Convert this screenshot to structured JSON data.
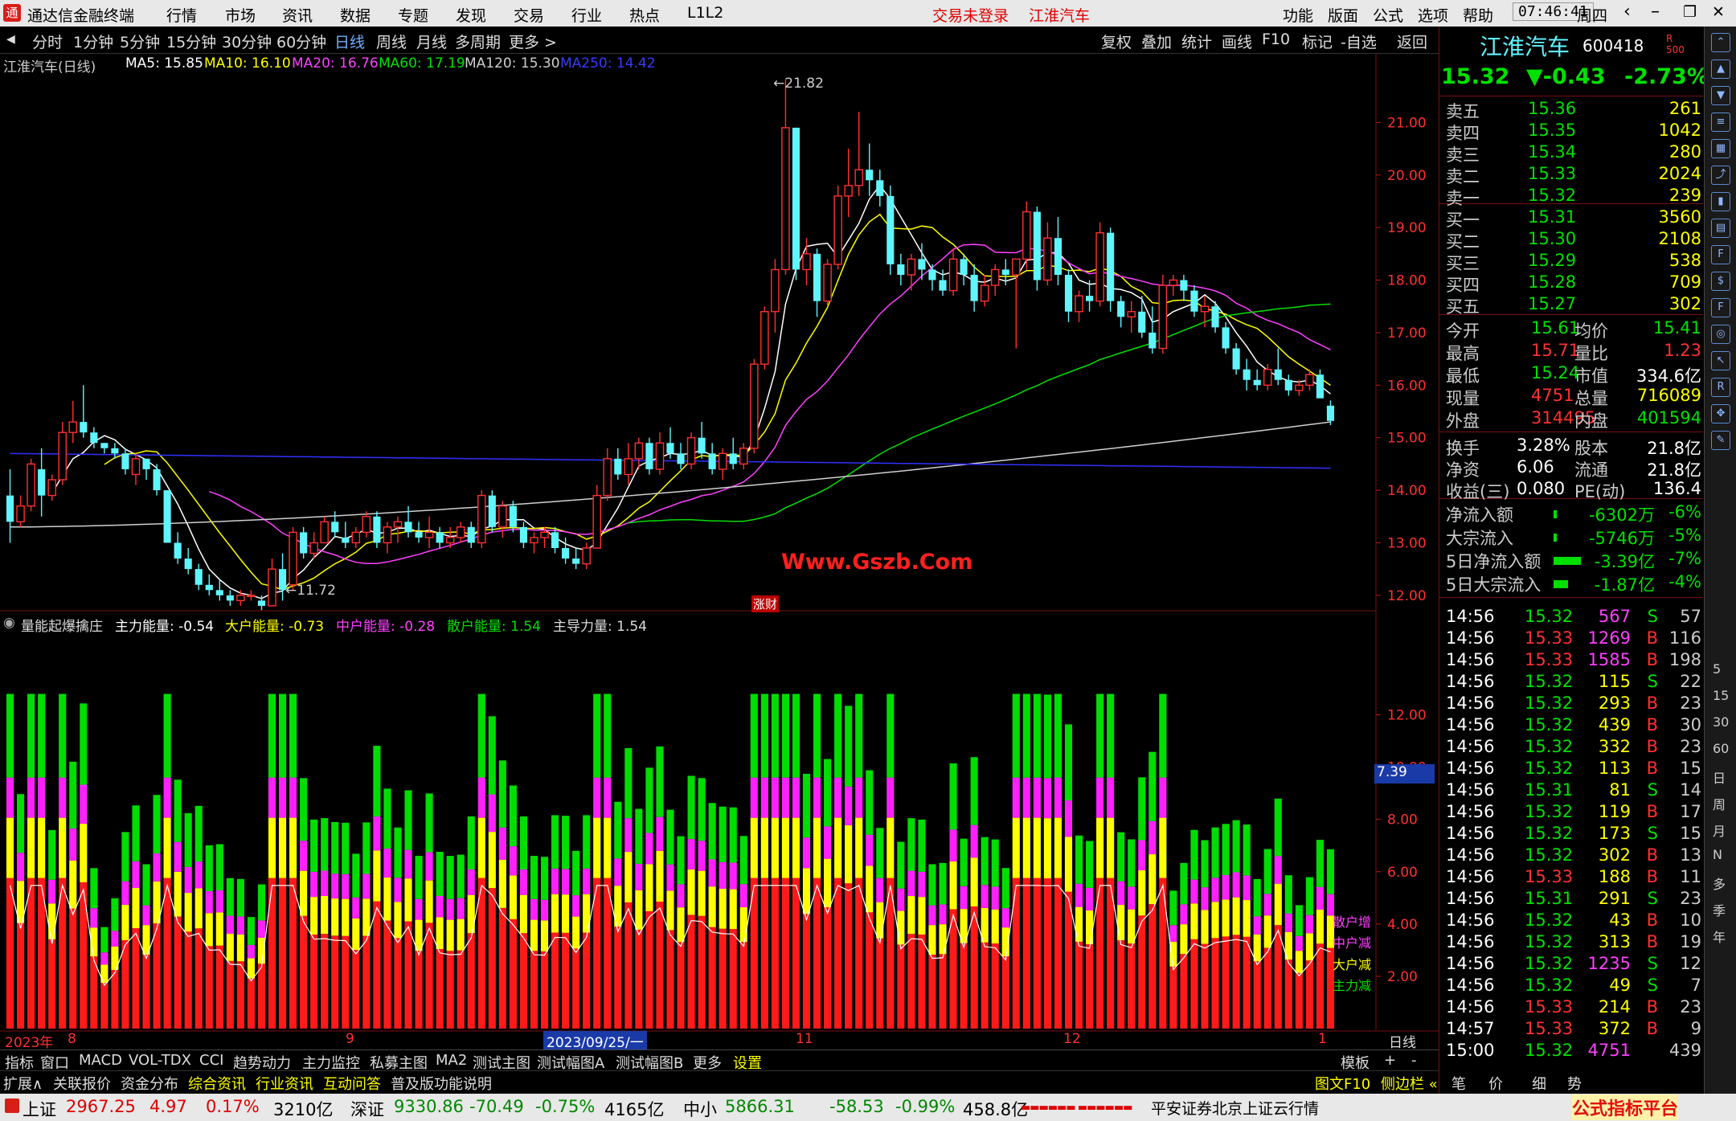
{
  "app": {
    "title": "通达信金融终端",
    "login": "交易未登录",
    "stock_title": "江淮汽车"
  },
  "menu": [
    "行情",
    "市场",
    "资讯",
    "数据",
    "专题",
    "发现",
    "交易",
    "行业",
    "热点",
    "L1L2"
  ],
  "right_menu": [
    "功能",
    "版面",
    "公式",
    "选项",
    "帮助"
  ],
  "clock": "07:46:41",
  "weekday": "周四",
  "periods": [
    "分时",
    "1分钟",
    "5分钟",
    "15分钟",
    "30分钟",
    "60分钟",
    "日线",
    "周线",
    "月线",
    "多周期",
    "更多 >"
  ],
  "period_active": "日线",
  "tools": [
    "复权",
    "叠加",
    "统计",
    "画线",
    "F10",
    "标记",
    "-自选",
    "返回"
  ],
  "ma": {
    "name": "江淮汽车(日线)",
    "ma5": "MA5: 15.85",
    "ma10": "MA10: 16.10",
    "ma20": "MA20: 16.76",
    "ma60": "MA60: 17.19",
    "ma120": "MA120: 15.30",
    "ma250": "MA250: 14.42"
  },
  "indicator": {
    "name": "量能起爆擒庄",
    "main": "主力能量: -0.54",
    "big": "大户能量: -0.73",
    "mid": "中户能量: -0.28",
    "retail": "散户能量: 1.54",
    "lead": "主导力量: 1.54",
    "current": "7.39",
    "tag_retail": "散户增",
    "tag_mid": "中户减",
    "tag_big": "大户减",
    "tag_main": "主力减"
  },
  "price_axis": [
    "21.00",
    "20.00",
    "19.00",
    "18.00",
    "17.00",
    "16.00",
    "15.00",
    "14.00",
    "13.00",
    "12.00"
  ],
  "ind_axis": [
    "12.00",
    "10.00",
    "8.00",
    "6.00",
    "4.00",
    "2.00"
  ],
  "high_label": "21.82",
  "low_label": "11.72",
  "watermark": "Www.Gszb.Com",
  "event_tag": "涨财",
  "date_axis": {
    "start": "2023年",
    "m8": "8",
    "m9": "9",
    "cursor": "2023/09/25/一",
    "m11": "11",
    "m12": "12",
    "m1": "1",
    "period": "日线"
  },
  "quote": {
    "name": "江淮汽车",
    "code": "600418",
    "price": "15.32",
    "change": "▼-0.43",
    "pct": "-2.73%"
  },
  "asks": [
    {
      "l": "卖五",
      "p": "15.36",
      "v": "261"
    },
    {
      "l": "卖四",
      "p": "15.35",
      "v": "1042"
    },
    {
      "l": "卖三",
      "p": "15.34",
      "v": "280"
    },
    {
      "l": "卖二",
      "p": "15.33",
      "v": "2024"
    },
    {
      "l": "卖一",
      "p": "15.32",
      "v": "239"
    }
  ],
  "bids": [
    {
      "l": "买一",
      "p": "15.31",
      "v": "3560"
    },
    {
      "l": "买二",
      "p": "15.30",
      "v": "2108"
    },
    {
      "l": "买三",
      "p": "15.29",
      "v": "538"
    },
    {
      "l": "买四",
      "p": "15.28",
      "v": "709"
    },
    {
      "l": "买五",
      "p": "15.27",
      "v": "302"
    }
  ],
  "stats1": [
    [
      "今开",
      "15.61",
      "均价",
      "15.41"
    ],
    [
      "最高",
      "15.71",
      "量比",
      "1.23"
    ],
    [
      "最低",
      "15.24",
      "市值",
      "334.6亿"
    ],
    [
      "现量",
      "4751",
      "总量",
      "716089"
    ],
    [
      "外盘",
      "314495",
      "内盘",
      "401594"
    ]
  ],
  "stats2": [
    [
      "换手",
      "3.28%",
      "股本",
      "21.8亿"
    ],
    [
      "净资",
      "6.06",
      "流通",
      "21.8亿"
    ],
    [
      "收益(三)",
      "0.080",
      "PE(动)",
      "136.4"
    ]
  ],
  "flows": [
    [
      "净流入额",
      "-6302万",
      "-6%"
    ],
    [
      "大宗流入",
      "-5746万",
      "-5%"
    ],
    [
      "5日净流入额",
      "-3.39亿",
      "-7%"
    ],
    [
      "5日大宗流入",
      "-1.87亿",
      "-4%"
    ]
  ],
  "ticks": [
    [
      "14:56",
      "15.32",
      "567",
      "S",
      "57"
    ],
    [
      "14:56",
      "15.33",
      "1269",
      "B",
      "116"
    ],
    [
      "14:56",
      "15.33",
      "1585",
      "B",
      "198"
    ],
    [
      "14:56",
      "15.32",
      "115",
      "S",
      "22"
    ],
    [
      "14:56",
      "15.32",
      "293",
      "B",
      "23"
    ],
    [
      "14:56",
      "15.32",
      "439",
      "B",
      "30"
    ],
    [
      "14:56",
      "15.32",
      "332",
      "B",
      "23"
    ],
    [
      "14:56",
      "15.32",
      "113",
      "B",
      "15"
    ],
    [
      "14:56",
      "15.31",
      "81",
      "S",
      "14"
    ],
    [
      "14:56",
      "15.32",
      "119",
      "B",
      "17"
    ],
    [
      "14:56",
      "15.32",
      "173",
      "S",
      "15"
    ],
    [
      "14:56",
      "15.32",
      "302",
      "B",
      "13"
    ],
    [
      "14:56",
      "15.33",
      "188",
      "B",
      "11"
    ],
    [
      "14:56",
      "15.31",
      "291",
      "S",
      "23"
    ],
    [
      "14:56",
      "15.32",
      "43",
      "B",
      "10"
    ],
    [
      "14:56",
      "15.32",
      "313",
      "B",
      "19"
    ],
    [
      "14:56",
      "15.32",
      "1235",
      "S",
      "12"
    ],
    [
      "14:56",
      "15.32",
      "49",
      "S",
      "7"
    ],
    [
      "14:56",
      "15.33",
      "214",
      "B",
      "23"
    ],
    [
      "14:57",
      "15.33",
      "372",
      "B",
      "9"
    ],
    [
      "15:00",
      "15.32",
      "4751",
      "",
      "439"
    ]
  ],
  "tabs1": [
    "指标",
    "窗口",
    "MACD",
    "VOL-TDX",
    "CCI",
    "趋势动力",
    "主力监控",
    "私募主图",
    "MA2",
    "测试主图",
    "测试幅图A",
    "测试幅图B",
    "更多",
    "设置"
  ],
  "tabs1_right": [
    "模板",
    "+",
    "-"
  ],
  "tabs2": [
    "扩展∧",
    "关联报价",
    "资金分布",
    "综合资讯",
    "行业资讯",
    "互动问答",
    "普及版功能说明"
  ],
  "tabs2_right": [
    "图文F10",
    "侧边栏 «",
    "笔",
    "价",
    "细",
    "势"
  ],
  "status": {
    "sh": "上证",
    "sh_val": "2967.25",
    "sh_chg": "4.97",
    "sh_pct": "0.17%",
    "sh_amt": "3210亿",
    "sz": "深证",
    "sz_val": "9330.86",
    "sz_chg": "-70.49",
    "sz_pct": "-0.75%",
    "sz_amt": "4165亿",
    "zx": "中小",
    "zx_val": "5866.31",
    "zx_chg": "-58.53",
    "zx_pct": "-0.99%",
    "zx_amt": "458.8亿",
    "broker": "平安证券北京上证云行情",
    "site": "公式指标平台",
    "site_url": "www.Gszb.Com"
  },
  "sidebar_text": [
    "5",
    "15",
    "30",
    "60",
    "日",
    "周",
    "月",
    "N",
    "多",
    "季",
    "年"
  ],
  "colors": {
    "up": "#ff3030",
    "down": "#5ff5ff",
    "ma5": "#ffffff",
    "ma10": "#ffff00",
    "ma20": "#ff40ff",
    "ma60": "#00e000",
    "ma120": "#cfcfcf",
    "ma250": "#3030ff"
  },
  "chart_data": {
    "type": "candlestick",
    "series": "江淮汽车 日线",
    "candles": [
      [
        13.9,
        14.4,
        13.0,
        13.4
      ],
      [
        13.4,
        13.9,
        13.3,
        13.7
      ],
      [
        13.7,
        14.6,
        13.6,
        14.5
      ],
      [
        14.4,
        14.8,
        13.5,
        13.9
      ],
      [
        13.9,
        14.3,
        13.8,
        14.2
      ],
      [
        14.2,
        15.3,
        14.1,
        15.1
      ],
      [
        15.1,
        15.7,
        14.9,
        15.3
      ],
      [
        15.3,
        16.0,
        15.0,
        15.1
      ],
      [
        15.1,
        15.2,
        14.8,
        14.9
      ],
      [
        14.9,
        14.9,
        14.7,
        14.8
      ],
      [
        14.8,
        14.9,
        14.6,
        14.7
      ],
      [
        14.7,
        14.8,
        14.3,
        14.4
      ],
      [
        14.3,
        14.7,
        14.1,
        14.6
      ],
      [
        14.6,
        14.6,
        14.2,
        14.4
      ],
      [
        14.4,
        14.5,
        13.9,
        14.0
      ],
      [
        14.0,
        14.0,
        13.0,
        13.0
      ],
      [
        13.0,
        13.2,
        12.6,
        12.7
      ],
      [
        12.7,
        12.9,
        12.4,
        12.5
      ],
      [
        12.5,
        12.6,
        12.1,
        12.2
      ],
      [
        12.2,
        12.4,
        12.0,
        12.1
      ],
      [
        12.1,
        12.3,
        11.9,
        12.0
      ],
      [
        12.0,
        12.1,
        11.8,
        11.9
      ],
      [
        11.9,
        12.1,
        11.8,
        12.0
      ],
      [
        12.0,
        12.1,
        11.9,
        12.0
      ],
      [
        11.9,
        12.0,
        11.72,
        11.8
      ],
      [
        11.8,
        12.7,
        11.8,
        12.5
      ],
      [
        12.5,
        12.8,
        11.9,
        12.1
      ],
      [
        12.2,
        13.3,
        12.1,
        13.2
      ],
      [
        13.2,
        13.3,
        12.7,
        12.8
      ],
      [
        12.8,
        13.2,
        12.7,
        13.0
      ],
      [
        13.0,
        13.5,
        13.0,
        13.4
      ],
      [
        13.4,
        13.6,
        13.1,
        13.2
      ],
      [
        13.1,
        13.4,
        12.9,
        13.0
      ],
      [
        13.0,
        13.3,
        12.9,
        13.2
      ],
      [
        13.2,
        13.6,
        13.1,
        13.5
      ],
      [
        13.5,
        13.6,
        12.9,
        13.0
      ],
      [
        13.0,
        13.4,
        12.8,
        13.3
      ],
      [
        13.3,
        13.5,
        13.0,
        13.4
      ],
      [
        13.4,
        13.7,
        13.1,
        13.2
      ],
      [
        13.2,
        13.4,
        13.0,
        13.1
      ],
      [
        13.1,
        13.5,
        12.9,
        13.2
      ],
      [
        13.2,
        13.3,
        12.9,
        13.0
      ],
      [
        13.0,
        13.3,
        12.9,
        13.1
      ],
      [
        13.1,
        13.4,
        13.0,
        13.3
      ],
      [
        13.3,
        13.4,
        12.9,
        13.0
      ],
      [
        13.0,
        14.0,
        12.9,
        13.9
      ],
      [
        13.9,
        14.0,
        13.2,
        13.3
      ],
      [
        13.3,
        13.8,
        13.1,
        13.7
      ],
      [
        13.7,
        13.8,
        13.2,
        13.3
      ],
      [
        13.3,
        13.4,
        12.9,
        13.0
      ],
      [
        13.0,
        13.2,
        12.8,
        13.1
      ],
      [
        13.1,
        13.3,
        12.9,
        13.2
      ],
      [
        13.2,
        13.3,
        12.8,
        12.9
      ],
      [
        12.9,
        13.1,
        12.6,
        12.7
      ],
      [
        12.7,
        12.9,
        12.5,
        12.6
      ],
      [
        12.6,
        13.0,
        12.5,
        12.9
      ],
      [
        12.9,
        14.1,
        12.9,
        13.9
      ],
      [
        13.9,
        14.8,
        13.8,
        14.6
      ],
      [
        14.6,
        14.8,
        14.2,
        14.3
      ],
      [
        14.3,
        14.9,
        14.1,
        14.6
      ],
      [
        14.6,
        15.0,
        14.4,
        14.9
      ],
      [
        14.9,
        15.0,
        14.3,
        14.4
      ],
      [
        14.4,
        15.1,
        14.3,
        14.9
      ],
      [
        14.9,
        15.2,
        14.6,
        14.7
      ],
      [
        14.7,
        14.9,
        14.4,
        14.5
      ],
      [
        14.5,
        15.1,
        14.4,
        15.0
      ],
      [
        15.0,
        15.3,
        14.6,
        14.7
      ],
      [
        14.7,
        14.9,
        14.3,
        14.4
      ],
      [
        14.4,
        14.8,
        14.2,
        14.7
      ],
      [
        14.7,
        15.0,
        14.4,
        14.5
      ],
      [
        14.5,
        14.9,
        14.4,
        14.8
      ],
      [
        14.8,
        16.5,
        14.7,
        16.4
      ],
      [
        16.4,
        17.5,
        16.3,
        17.4
      ],
      [
        17.4,
        18.4,
        17.0,
        18.2
      ],
      [
        18.2,
        21.82,
        18.1,
        20.9
      ],
      [
        20.9,
        20.9,
        18.0,
        18.2
      ],
      [
        18.2,
        18.8,
        17.9,
        18.5
      ],
      [
        18.5,
        18.6,
        17.3,
        17.6
      ],
      [
        17.6,
        18.4,
        17.5,
        18.3
      ],
      [
        18.3,
        19.8,
        18.2,
        19.6
      ],
      [
        19.6,
        20.5,
        19.2,
        19.8
      ],
      [
        19.8,
        21.2,
        19.6,
        20.1
      ],
      [
        20.1,
        20.6,
        19.6,
        19.9
      ],
      [
        19.9,
        20.1,
        19.4,
        19.6
      ],
      [
        19.6,
        19.8,
        18.1,
        18.3
      ],
      [
        18.3,
        18.5,
        17.9,
        18.1
      ],
      [
        18.1,
        18.5,
        17.8,
        18.4
      ],
      [
        18.4,
        18.7,
        18.0,
        18.2
      ],
      [
        18.2,
        18.3,
        17.8,
        18.0
      ],
      [
        18.0,
        18.2,
        17.7,
        17.8
      ],
      [
        17.8,
        18.6,
        17.7,
        18.4
      ],
      [
        18.4,
        18.5,
        17.9,
        18.1
      ],
      [
        18.1,
        18.3,
        17.4,
        17.6
      ],
      [
        17.6,
        18.1,
        17.5,
        17.9
      ],
      [
        17.9,
        18.3,
        17.7,
        18.2
      ],
      [
        18.2,
        18.4,
        17.9,
        18.1
      ],
      [
        18.1,
        18.4,
        16.7,
        18.4
      ],
      [
        18.4,
        19.5,
        18.2,
        19.3
      ],
      [
        19.3,
        19.4,
        17.8,
        18.0
      ],
      [
        18.0,
        19.1,
        17.9,
        18.8
      ],
      [
        18.8,
        19.2,
        17.9,
        18.1
      ],
      [
        18.1,
        18.2,
        17.2,
        17.4
      ],
      [
        17.4,
        17.8,
        17.2,
        17.7
      ],
      [
        17.7,
        18.0,
        17.4,
        17.6
      ],
      [
        17.6,
        19.1,
        17.5,
        18.9
      ],
      [
        18.9,
        19.0,
        17.4,
        17.6
      ],
      [
        17.6,
        17.7,
        17.1,
        17.3
      ],
      [
        17.3,
        17.6,
        17.0,
        17.4
      ],
      [
        17.4,
        17.7,
        16.9,
        17.0
      ],
      [
        17.0,
        17.5,
        16.6,
        16.7
      ],
      [
        16.7,
        18.1,
        16.6,
        17.9
      ],
      [
        17.9,
        18.1,
        17.7,
        18.0
      ],
      [
        18.0,
        18.1,
        17.6,
        17.8
      ],
      [
        17.8,
        17.9,
        17.3,
        17.4
      ],
      [
        17.4,
        17.7,
        17.1,
        17.5
      ],
      [
        17.5,
        17.6,
        17.0,
        17.1
      ],
      [
        17.1,
        17.2,
        16.6,
        16.7
      ],
      [
        16.7,
        16.8,
        16.2,
        16.3
      ],
      [
        16.3,
        16.5,
        15.9,
        16.1
      ],
      [
        16.1,
        16.3,
        15.9,
        16.0
      ],
      [
        16.0,
        16.4,
        15.9,
        16.3
      ],
      [
        16.3,
        16.7,
        16.0,
        16.1
      ],
      [
        16.1,
        16.2,
        15.8,
        15.9
      ],
      [
        15.9,
        16.1,
        15.8,
        16.0
      ],
      [
        16.0,
        16.3,
        15.9,
        16.2
      ],
      [
        16.2,
        16.3,
        15.8,
        15.75
      ],
      [
        15.61,
        15.71,
        15.24,
        15.32
      ]
    ],
    "ma": {
      "MA5": 15.85,
      "MA10": 16.1,
      "MA20": 16.76,
      "MA60": 17.19,
      "MA120": 15.3,
      "MA250": 14.42
    },
    "y_range": [
      11.6,
      22.0
    ],
    "indicator_range": [
      0,
      13
    ],
    "indicator_series": [
      "主力能量",
      "大户能量",
      "中户能量",
      "散户能量"
    ]
  }
}
